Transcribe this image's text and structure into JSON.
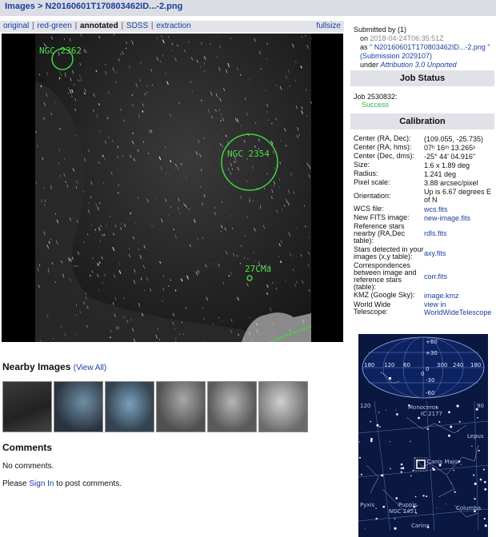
{
  "header": {
    "breadcrumb_root": "Images",
    "breadcrumb_sep": " > ",
    "filename": "N20160601T170803462ID...-2.png"
  },
  "viewbar": {
    "links": [
      "original",
      "red-green"
    ],
    "current": "annotated",
    "links_after": [
      "SDSS",
      "extraction"
    ],
    "fullsize": "fullsize"
  },
  "annotations": [
    {
      "label": "NGC 2362"
    },
    {
      "label": "NGC 2354"
    },
    {
      "label": "27CMa"
    }
  ],
  "nearby": {
    "title": "Nearby Images",
    "view_all": "(View All)"
  },
  "comments": {
    "title": "Comments",
    "none": "No comments.",
    "signin_prefix": "Please ",
    "signin_link": "Sign In",
    "signin_suffix": " to post comments."
  },
  "submission": {
    "submitted_by": "Submitted by (1)",
    "on_label": "on",
    "date": "2018-04-24T06:35:51Z",
    "as_label": "as",
    "as_file": "\" N20160601T170803462ID...-2.png \"",
    "submission_id": "(Submission 2029107)",
    "under_label": "under",
    "license": "Attribution 3.0 Unported"
  },
  "job_status": {
    "title": "Job Status",
    "job": "Job 2530832:",
    "status": "Success"
  },
  "calibration": {
    "title": "Calibration",
    "rows": [
      {
        "k": "Center (RA, Dec):",
        "v": "(109.055, -25.735)"
      },
      {
        "k": "Center (RA, hms):",
        "v": "07ʰ 16ᵐ 13.265ˢ"
      },
      {
        "k": "Center (Dec, dms):",
        "v": "-25° 44' 04.916\""
      },
      {
        "k": "Size:",
        "v": "1.6 x 1.89 deg"
      },
      {
        "k": "Radius:",
        "v": "1.241 deg"
      },
      {
        "k": "Pixel scale:",
        "v": "3.88 arcsec/pixel"
      },
      {
        "k": "Orientation:",
        "v": "Up is 6.67 degrees E of N"
      },
      {
        "k": "WCS file:",
        "v": "wcs.fits",
        "link": true
      },
      {
        "k": "New FITS image:",
        "v": "new-image.fits",
        "link": true
      },
      {
        "k": "Reference stars nearby (RA,Dec table):",
        "v": "rdls.fits",
        "link": true
      },
      {
        "k": "Stars detected in your images (x,y table):",
        "v": "axy.fits",
        "link": true
      },
      {
        "k": "Correspondences between image and reference stars (table):",
        "v": "corr.fits",
        "link": true
      },
      {
        "k": "KMZ (Google Sky):",
        "v": "image.kmz",
        "link": true
      },
      {
        "k": "World Wide Telescope:",
        "v": "view in WorldWideTelescope",
        "link": true
      }
    ]
  },
  "skymap": {
    "lat_labels": [
      "+60",
      "+30",
      "0",
      "-30",
      "-60"
    ],
    "lon_labels": [
      "180",
      "120",
      "60",
      "0",
      "300",
      "240",
      "180"
    ]
  },
  "zoommap": {
    "labels": [
      "Monoceros",
      "IC 2177",
      "Lepus",
      "Canis Major",
      "Puppis",
      "NGC 2451",
      "Columba",
      "Pyxis",
      "Carina",
      "120",
      "90"
    ]
  }
}
